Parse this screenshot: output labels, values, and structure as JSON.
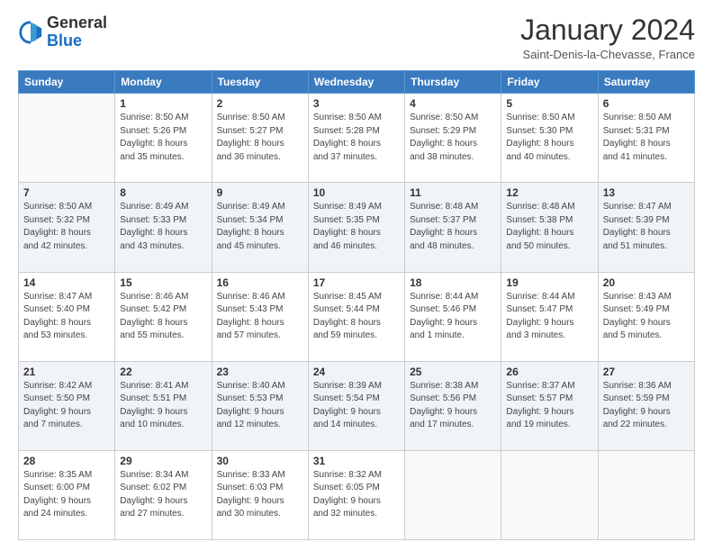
{
  "logo": {
    "general": "General",
    "blue": "Blue"
  },
  "header": {
    "month": "January 2024",
    "location": "Saint-Denis-la-Chevasse, France"
  },
  "weekdays": [
    "Sunday",
    "Monday",
    "Tuesday",
    "Wednesday",
    "Thursday",
    "Friday",
    "Saturday"
  ],
  "weeks": [
    [
      {
        "day": "",
        "sunrise": "",
        "sunset": "",
        "daylight": ""
      },
      {
        "day": "1",
        "sunrise": "Sunrise: 8:50 AM",
        "sunset": "Sunset: 5:26 PM",
        "daylight": "Daylight: 8 hours and 35 minutes."
      },
      {
        "day": "2",
        "sunrise": "Sunrise: 8:50 AM",
        "sunset": "Sunset: 5:27 PM",
        "daylight": "Daylight: 8 hours and 36 minutes."
      },
      {
        "day": "3",
        "sunrise": "Sunrise: 8:50 AM",
        "sunset": "Sunset: 5:28 PM",
        "daylight": "Daylight: 8 hours and 37 minutes."
      },
      {
        "day": "4",
        "sunrise": "Sunrise: 8:50 AM",
        "sunset": "Sunset: 5:29 PM",
        "daylight": "Daylight: 8 hours and 38 minutes."
      },
      {
        "day": "5",
        "sunrise": "Sunrise: 8:50 AM",
        "sunset": "Sunset: 5:30 PM",
        "daylight": "Daylight: 8 hours and 40 minutes."
      },
      {
        "day": "6",
        "sunrise": "Sunrise: 8:50 AM",
        "sunset": "Sunset: 5:31 PM",
        "daylight": "Daylight: 8 hours and 41 minutes."
      }
    ],
    [
      {
        "day": "7",
        "sunrise": "Sunrise: 8:50 AM",
        "sunset": "Sunset: 5:32 PM",
        "daylight": "Daylight: 8 hours and 42 minutes."
      },
      {
        "day": "8",
        "sunrise": "Sunrise: 8:49 AM",
        "sunset": "Sunset: 5:33 PM",
        "daylight": "Daylight: 8 hours and 43 minutes."
      },
      {
        "day": "9",
        "sunrise": "Sunrise: 8:49 AM",
        "sunset": "Sunset: 5:34 PM",
        "daylight": "Daylight: 8 hours and 45 minutes."
      },
      {
        "day": "10",
        "sunrise": "Sunrise: 8:49 AM",
        "sunset": "Sunset: 5:35 PM",
        "daylight": "Daylight: 8 hours and 46 minutes."
      },
      {
        "day": "11",
        "sunrise": "Sunrise: 8:48 AM",
        "sunset": "Sunset: 5:37 PM",
        "daylight": "Daylight: 8 hours and 48 minutes."
      },
      {
        "day": "12",
        "sunrise": "Sunrise: 8:48 AM",
        "sunset": "Sunset: 5:38 PM",
        "daylight": "Daylight: 8 hours and 50 minutes."
      },
      {
        "day": "13",
        "sunrise": "Sunrise: 8:47 AM",
        "sunset": "Sunset: 5:39 PM",
        "daylight": "Daylight: 8 hours and 51 minutes."
      }
    ],
    [
      {
        "day": "14",
        "sunrise": "Sunrise: 8:47 AM",
        "sunset": "Sunset: 5:40 PM",
        "daylight": "Daylight: 8 hours and 53 minutes."
      },
      {
        "day": "15",
        "sunrise": "Sunrise: 8:46 AM",
        "sunset": "Sunset: 5:42 PM",
        "daylight": "Daylight: 8 hours and 55 minutes."
      },
      {
        "day": "16",
        "sunrise": "Sunrise: 8:46 AM",
        "sunset": "Sunset: 5:43 PM",
        "daylight": "Daylight: 8 hours and 57 minutes."
      },
      {
        "day": "17",
        "sunrise": "Sunrise: 8:45 AM",
        "sunset": "Sunset: 5:44 PM",
        "daylight": "Daylight: 8 hours and 59 minutes."
      },
      {
        "day": "18",
        "sunrise": "Sunrise: 8:44 AM",
        "sunset": "Sunset: 5:46 PM",
        "daylight": "Daylight: 9 hours and 1 minute."
      },
      {
        "day": "19",
        "sunrise": "Sunrise: 8:44 AM",
        "sunset": "Sunset: 5:47 PM",
        "daylight": "Daylight: 9 hours and 3 minutes."
      },
      {
        "day": "20",
        "sunrise": "Sunrise: 8:43 AM",
        "sunset": "Sunset: 5:49 PM",
        "daylight": "Daylight: 9 hours and 5 minutes."
      }
    ],
    [
      {
        "day": "21",
        "sunrise": "Sunrise: 8:42 AM",
        "sunset": "Sunset: 5:50 PM",
        "daylight": "Daylight: 9 hours and 7 minutes."
      },
      {
        "day": "22",
        "sunrise": "Sunrise: 8:41 AM",
        "sunset": "Sunset: 5:51 PM",
        "daylight": "Daylight: 9 hours and 10 minutes."
      },
      {
        "day": "23",
        "sunrise": "Sunrise: 8:40 AM",
        "sunset": "Sunset: 5:53 PM",
        "daylight": "Daylight: 9 hours and 12 minutes."
      },
      {
        "day": "24",
        "sunrise": "Sunrise: 8:39 AM",
        "sunset": "Sunset: 5:54 PM",
        "daylight": "Daylight: 9 hours and 14 minutes."
      },
      {
        "day": "25",
        "sunrise": "Sunrise: 8:38 AM",
        "sunset": "Sunset: 5:56 PM",
        "daylight": "Daylight: 9 hours and 17 minutes."
      },
      {
        "day": "26",
        "sunrise": "Sunrise: 8:37 AM",
        "sunset": "Sunset: 5:57 PM",
        "daylight": "Daylight: 9 hours and 19 minutes."
      },
      {
        "day": "27",
        "sunrise": "Sunrise: 8:36 AM",
        "sunset": "Sunset: 5:59 PM",
        "daylight": "Daylight: 9 hours and 22 minutes."
      }
    ],
    [
      {
        "day": "28",
        "sunrise": "Sunrise: 8:35 AM",
        "sunset": "Sunset: 6:00 PM",
        "daylight": "Daylight: 9 hours and 24 minutes."
      },
      {
        "day": "29",
        "sunrise": "Sunrise: 8:34 AM",
        "sunset": "Sunset: 6:02 PM",
        "daylight": "Daylight: 9 hours and 27 minutes."
      },
      {
        "day": "30",
        "sunrise": "Sunrise: 8:33 AM",
        "sunset": "Sunset: 6:03 PM",
        "daylight": "Daylight: 9 hours and 30 minutes."
      },
      {
        "day": "31",
        "sunrise": "Sunrise: 8:32 AM",
        "sunset": "Sunset: 6:05 PM",
        "daylight": "Daylight: 9 hours and 32 minutes."
      },
      {
        "day": "",
        "sunrise": "",
        "sunset": "",
        "daylight": ""
      },
      {
        "day": "",
        "sunrise": "",
        "sunset": "",
        "daylight": ""
      },
      {
        "day": "",
        "sunrise": "",
        "sunset": "",
        "daylight": ""
      }
    ]
  ]
}
